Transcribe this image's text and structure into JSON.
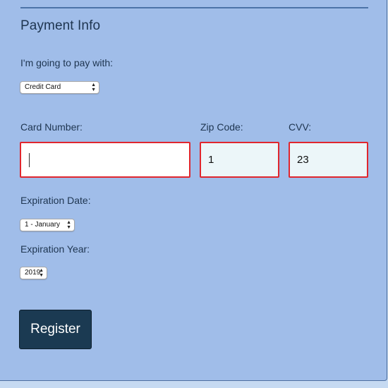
{
  "payment": {
    "title": "Payment Info",
    "pay_with_label": "I'm going to pay with:",
    "pay_with_selected": "Credit Card",
    "card_number_label": "Card Number:",
    "card_number_value": "",
    "zip_label": "Zip Code:",
    "zip_value": "1",
    "cvv_label": "CVV:",
    "cvv_value": "23",
    "exp_date_label": "Expiration Date:",
    "exp_date_selected": "1 - January",
    "exp_year_label": "Expiration Year:",
    "exp_year_selected": "2019",
    "register_label": "Register"
  },
  "colors": {
    "panel_bg": "#a0bde9",
    "page_bg": "#c6daf2",
    "error_border": "#e0262e",
    "button_bg": "#1b3a52",
    "text": "#1e3550"
  }
}
